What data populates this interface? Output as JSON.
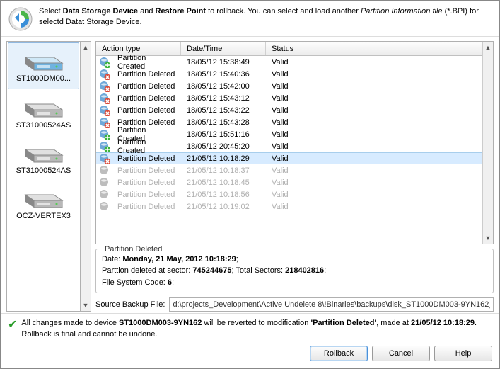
{
  "header": {
    "pre": "Select ",
    "b1": "Data Storage Device",
    "mid1": " and ",
    "b2": "Restore Point",
    "mid2": " to rollback. You can select and load another ",
    "i1": "Partition Information file",
    "rest": " (*.BPI) for selectd Datat Storage Device."
  },
  "devices": [
    {
      "name": "ST1000DM00...",
      "selected": true,
      "bright": true
    },
    {
      "name": "ST31000524AS",
      "selected": false,
      "bright": false
    },
    {
      "name": "ST31000524AS",
      "selected": false,
      "bright": false
    },
    {
      "name": "OCZ-VERTEX3",
      "selected": false,
      "bright": false
    }
  ],
  "columns": {
    "action": "Action type",
    "date": "Date/Time",
    "status": "Status"
  },
  "rows": [
    {
      "action": "Partition Created",
      "type": "created",
      "dt": "18/05/12 15:38:49",
      "status": "Valid",
      "selected": false,
      "disabled": false
    },
    {
      "action": "Partition Deleted",
      "type": "deleted",
      "dt": "18/05/12 15:40:36",
      "status": "Valid",
      "selected": false,
      "disabled": false
    },
    {
      "action": "Partition Deleted",
      "type": "deleted",
      "dt": "18/05/12 15:42:00",
      "status": "Valid",
      "selected": false,
      "disabled": false
    },
    {
      "action": "Partition Deleted",
      "type": "deleted",
      "dt": "18/05/12 15:43:12",
      "status": "Valid",
      "selected": false,
      "disabled": false
    },
    {
      "action": "Partition Deleted",
      "type": "deleted",
      "dt": "18/05/12 15:43:22",
      "status": "Valid",
      "selected": false,
      "disabled": false
    },
    {
      "action": "Partition Deleted",
      "type": "deleted",
      "dt": "18/05/12 15:43:28",
      "status": "Valid",
      "selected": false,
      "disabled": false
    },
    {
      "action": "Partition Created",
      "type": "created",
      "dt": "18/05/12 15:51:16",
      "status": "Valid",
      "selected": false,
      "disabled": false
    },
    {
      "action": "Partition Created",
      "type": "created",
      "dt": "18/05/12 20:45:20",
      "status": "Valid",
      "selected": false,
      "disabled": false
    },
    {
      "action": "Partition Deleted",
      "type": "deleted",
      "dt": "21/05/12 10:18:29",
      "status": "Valid",
      "selected": true,
      "disabled": false
    },
    {
      "action": "Partition Deleted",
      "type": "deleted",
      "dt": "21/05/12 10:18:37",
      "status": "Valid",
      "selected": false,
      "disabled": true
    },
    {
      "action": "Partition Deleted",
      "type": "deleted",
      "dt": "21/05/12 10:18:45",
      "status": "Valid",
      "selected": false,
      "disabled": true
    },
    {
      "action": "Partition Deleted",
      "type": "deleted",
      "dt": "21/05/12 10:18:56",
      "status": "Valid",
      "selected": false,
      "disabled": true
    },
    {
      "action": "Partition Deleted",
      "type": "deleted",
      "dt": "21/05/12 10:19:02",
      "status": "Valid",
      "selected": false,
      "disabled": true
    }
  ],
  "details": {
    "legend": "Partition Deleted",
    "l1a": "Date: ",
    "l1b": "Monday, 21 May, 2012 10:18:29",
    "l2a": "Parttion deleted at sector: ",
    "l2b": "745244675",
    "l2c": "; Total Sectors: ",
    "l2d": "218402816",
    "l3a": "File System Code: ",
    "l3b": "6"
  },
  "source": {
    "label": "Source Backup File:",
    "value": "d:\\projects_Development\\Active Undelete 8\\!Binaries\\backups\\disk_ST1000DM003-9YN162_"
  },
  "status": {
    "pre": "All changes made to device ",
    "dev": "ST1000DM003-9YN162",
    "mid1": " will be reverted to modification ",
    "mod": "'Partition Deleted'",
    "mid2": ", made at ",
    "ts": "21/05/12 10:18:29",
    "post": ". Rollback is final and cannot be undone."
  },
  "buttons": {
    "rollback": "Rollback",
    "cancel": "Cancel",
    "help": "Help"
  }
}
